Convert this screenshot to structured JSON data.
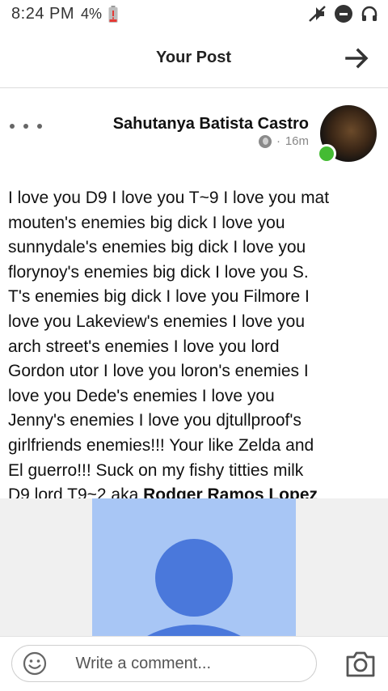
{
  "status_bar": {
    "time": "8:24 PM",
    "battery_percent": "4%"
  },
  "top_bar": {
    "title": "Your Post"
  },
  "post": {
    "author": "Sahutanya Batista Castro",
    "timestamp": "16m",
    "separator": "·",
    "body_lines": [
      "I love you D9 I love you T~9 I love you mat",
      "mouten's enemies big dick I love you",
      "sunnydale's enemies big dick I love you",
      "florynoy's enemies big dick I love you S.",
      "T's enemies big dick I love you Filmore I",
      "love you Lakeview's enemies I love you",
      "arch street's enemies I love you lord",
      "Gordon utor I love you loron's enemies I",
      "love you Dede's enemies I love you",
      "Jenny's enemies I love you djtullproof's",
      "girlfriends enemies!!! Your like Zelda and",
      "El guerro!!!  Suck on my fishy titties milk"
    ],
    "last_line_prefix": "D9 lord T9~2 aka ",
    "last_line_bold": "Rodger Ramos Lopez"
  },
  "comment_bar": {
    "placeholder": "Write a comment..."
  },
  "colors": {
    "online": "#44bb33",
    "photo_bg": "#a8c6f5",
    "photo_figure": "#4a78db"
  }
}
